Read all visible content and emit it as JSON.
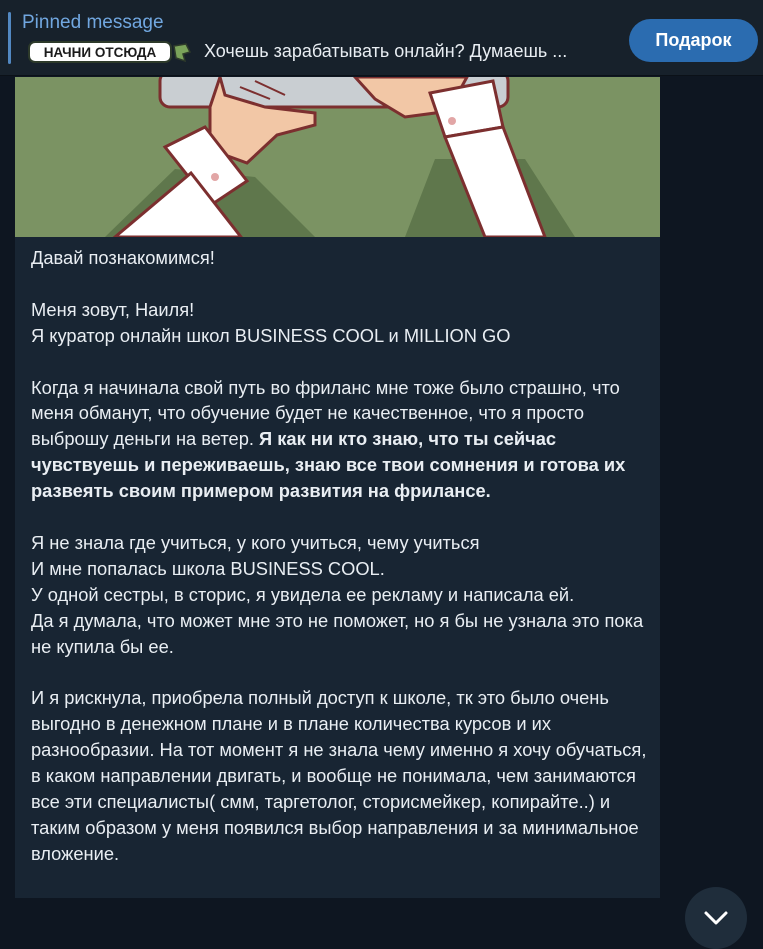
{
  "pinned": {
    "title": "Pinned message",
    "sticker_text": "НАЧНИ ОТСЮДА",
    "preview_text": "Хочешь зарабатывать онлайн? Думаешь ...",
    "gift_button_label": "Подарок"
  },
  "message": {
    "illustration": "hands-on-laptop-illustration",
    "paragraphs": [
      {
        "lines": [
          {
            "text": "Давай познакомимся!"
          }
        ]
      },
      {
        "lines": [
          {
            "text": "Меня зовут, Наиля!"
          },
          {
            "text": "Я куратор онлайн школ BUSINESS COOL и MILLION GO"
          }
        ]
      },
      {
        "lines": [
          {
            "text": "Когда я начинала свой путь во фриланс мне тоже было страшно, что меня обманут, что обучение будет не качественное, что я просто выброшу деньги на ветер. "
          },
          {
            "text": "Я как ни кто знаю, что ты сейчас чувствуешь и переживаешь, знаю все твои сомнения  и готова их развеять своим примером развития на фрилансе.",
            "bold": true
          }
        ]
      },
      {
        "lines": [
          {
            "text": "Я не знала где учиться, у кого учиться, чему учиться"
          },
          {
            "text": "И мне попалась школа BUSINESS COOL."
          },
          {
            "text": "У одной сестры, в сторис, я увидела ее рекламу и написала ей."
          },
          {
            "text": "Да я думала, что может мне это не поможет, но я бы не узнала это пока не купила бы ее."
          }
        ]
      },
      {
        "lines": [
          {
            "text": "И я рискнула, приобрела полный доступ к школе, тк это было очень выгодно в денежном плане и в плане количества курсов и их разнообразии. На тот момент я не знала чему именно я хочу обучаться, в каком направлении двигать, и вообще не понимала, чем занимаются все эти специалисты( смм, таргетолог, сторисмейкер, копирайте..) и таким образом у меня появился выбор направления и за минимальное вложение."
          }
        ]
      }
    ]
  },
  "scroll_down_icon": "chevron-down-icon",
  "colors": {
    "background": "#0e1621",
    "header": "#17212b",
    "bubble": "#182533",
    "accent": "#5288c1",
    "button": "#2b6cb0",
    "illustration_bg": "#7b9363"
  }
}
